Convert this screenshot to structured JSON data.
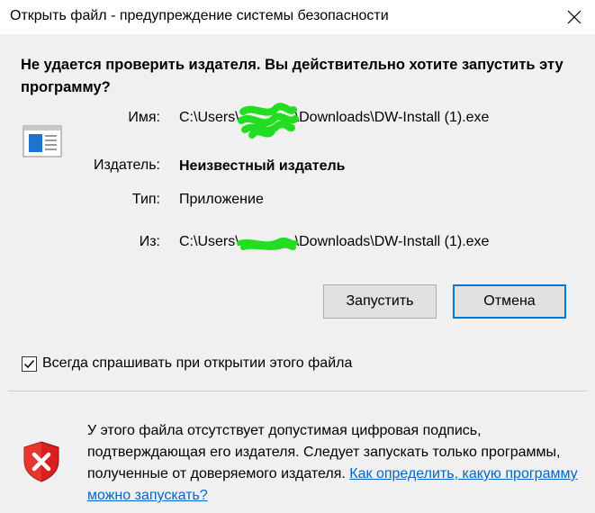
{
  "window": {
    "title": "Открыть файл - предупреждение системы безопасности",
    "close_glyph": "✕"
  },
  "dialog": {
    "question": "Не удается проверить издателя.  Вы действительно хотите запустить эту программу?",
    "fields": {
      "name_label": "Имя:",
      "name_prefix": "C:\\Users\\",
      "name_suffix": "\\Downloads\\DW-Install (1).exe",
      "publisher_label": "Издатель:",
      "publisher_value": "Неизвестный издатель",
      "type_label": "Тип:",
      "type_value": "Приложение",
      "from_label": "Из:",
      "from_prefix": "C:\\Users\\",
      "from_suffix": "\\Downloads\\DW-Install (1).exe"
    },
    "buttons": {
      "run_label": "Запустить",
      "cancel_label": "Отмена"
    },
    "checkbox": {
      "label": "Всегда спрашивать при открытии этого файла",
      "checked": true
    }
  },
  "footer": {
    "warning_text": "У этого файла отсутствует допустимая цифровая подпись, подтверждающая его издателя.  Следует запускать только программы, полученные от доверяемого издателя.  ",
    "help_link": "Как определить, какую программу можно запускать?"
  },
  "colors": {
    "accent": "#0078d7",
    "link": "#0066cc",
    "redaction": "#22dd22",
    "shield_red": "#d9201f"
  }
}
